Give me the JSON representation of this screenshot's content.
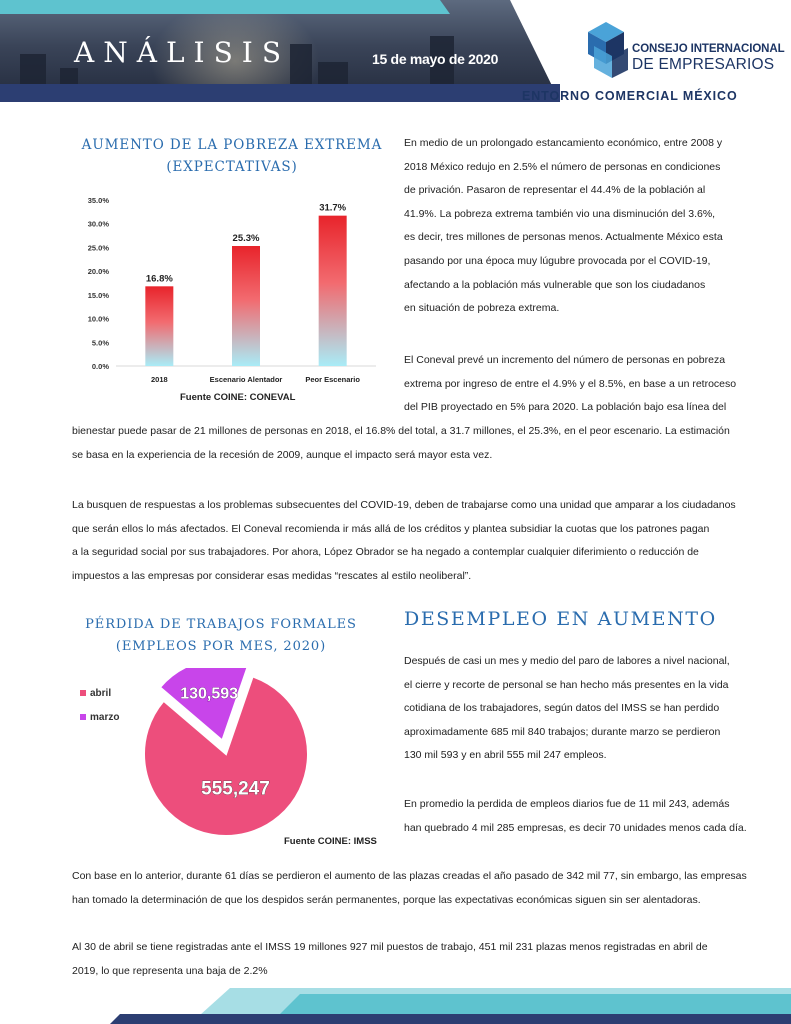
{
  "header": {
    "title": "ANÁLISIS",
    "date": "15 de mayo de 2020",
    "org_line1": "CONSEJO INTERNACIONAL",
    "org_line2": "DE EMPRESARIOS",
    "subtitle": "ENTORNO COMERCIAL MÉXICO"
  },
  "section1": {
    "heading_line1": "AUMENTO DE LA POBREZA EXTREMA",
    "heading_line2": "(EXPECTATIVAS)",
    "source": "Fuente COINE:  CONEVAL",
    "para1": [
      "En medio de un prolongado estancamiento económico, entre 2008 y",
      "2018 México redujo en 2.5% el número de personas en condiciones",
      "de privación. Pasaron de representar el 44.4% de la población al",
      "41.9%. La pobreza extrema también vio una disminución del 3.6%,",
      "es decir, tres millones de personas menos. Actualmente México esta",
      "pasando por una época muy lúgubre provocada por el COVID-19,",
      "afectando a la población más vulnerable que son los ciudadanos",
      "en situación de pobreza extrema."
    ],
    "para2_narrow": [
      " El Coneval prevé un incremento del número de personas en pobreza",
      "extrema por ingreso de entre el 4.9% y el 8.5%, en base a un retroceso",
      "del PIB proyectado en 5% para 2020. La población bajo esa línea del"
    ],
    "para2_wide": [
      "bienestar puede pasar de 21 millones de personas en 2018, el 16.8% del total, a 31.7 millones, el 25.3%, en el peor escenario. La estimación",
      "se basa en la experiencia de la recesión de 2009, aunque el impacto será mayor esta vez."
    ],
    "para3": [
      "La busquen de respuestas a los problemas subsecuentes del COVID-19, deben de trabajarse como una unidad que amparar a los ciudadanos",
      "que serán ellos lo más afectados. El Coneval recomienda ir más allá de los créditos y plantea subsidiar la cuotas que los patrones pagan",
      "a la seguridad social por sus trabajadores. Por ahora, López Obrador se ha negado a contemplar cualquier diferimiento o reducción de",
      "impuestos a las empresas por considerar esas medidas “rescates al estilo neoliberal”."
    ]
  },
  "section2": {
    "heading_line1": "PÉRDIDA DE TRABAJOS FORMALES",
    "heading_line2": "(EMPLEOS POR MES, 2020)",
    "source": "Fuente COINE:  IMSS",
    "big_heading": "DESEMPLEO EN AUMENTO",
    "para1": [
      "Después de casi un mes y medio del paro de labores a nivel nacional,",
      "el cierre y recorte de personal se han hecho más presentes en la vida",
      "cotidiana de los trabajadores, según datos del IMSS se han perdido",
      "aproximadamente 685 mil 840 trabajos; durante marzo se perdieron",
      "130 mil 593 y en abril 555 mil 247 empleos."
    ],
    "para2": [
      "En promedio la perdida de empleos diarios fue de 11 mil 243, además",
      "han quebrado 4 mil 285 empresas, es decir 70 unidades menos cada día."
    ],
    "para3": [
      "Con base en lo anterior, durante 61 días se perdieron el aumento de las plazas creadas el año pasado de 342 mil 77,  sin embargo, las empresas",
      "han tomado la determinación de que los despidos serán permanentes, porque las expectativas económicas siguen sin ser alentadoras."
    ],
    "para4": [
      "Al 30 de abril se tiene registradas ante el IMSS 19 millones 927 mil puestos de trabajo, 451 mil 231 plazas menos registradas en abril de",
      "2019, lo que representa una baja de 2.2%"
    ]
  },
  "chart_data": [
    {
      "type": "bar",
      "categories": [
        "2018",
        "Escenario Alentador",
        "Peor Escenario"
      ],
      "values": [
        16.8,
        25.3,
        31.7
      ],
      "data_labels": [
        "16.8%",
        "25.3%",
        "31.7%"
      ],
      "y_ticks": [
        "0.0%",
        "5.0%",
        "10.0%",
        "15.0%",
        "20.0%",
        "25.0%",
        "30.0%",
        "35.0%"
      ],
      "ylim": [
        0,
        35
      ],
      "grid": false,
      "colors": {
        "top": "#e8242b",
        "bottom": "#a9ecf7"
      }
    },
    {
      "type": "pie",
      "categories": [
        "abril",
        "marzo"
      ],
      "values": [
        555247,
        130593
      ],
      "data_labels": [
        "555,247",
        "130,593"
      ],
      "legend": "top-left",
      "colors": [
        "#ed4e7c",
        "#c845ea"
      ]
    }
  ]
}
